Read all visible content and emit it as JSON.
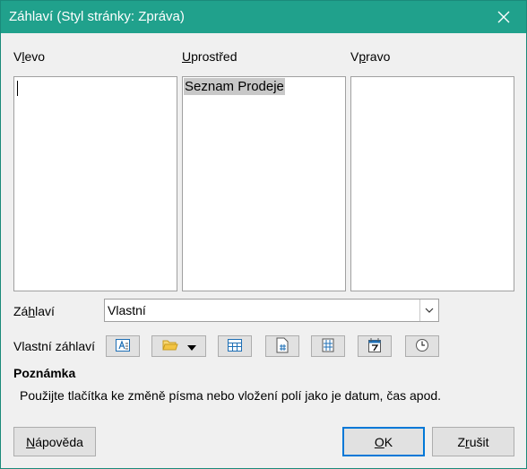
{
  "window": {
    "title": "Záhlaví (Styl stránky: Zpráva)"
  },
  "panes": {
    "left_label_pre": "V",
    "left_label_acc": "l",
    "left_label_post": "evo",
    "center_label_pre": "",
    "center_label_acc": "U",
    "center_label_post": "prostřed",
    "right_label_pre": "V",
    "right_label_acc": "p",
    "right_label_post": "ravo",
    "center_content": "Seznam Prodeje"
  },
  "header": {
    "label_pre": "Zá",
    "label_acc": "h",
    "label_post": "laví",
    "selected_value": "Vlastní"
  },
  "custom_header": {
    "label": "Vlastní záhlaví",
    "icons": [
      "text-attributes-icon",
      "open-file-icon",
      "title-icon",
      "sheet-name-icon",
      "page-icon",
      "date-icon",
      "time-icon"
    ]
  },
  "note": {
    "heading": "Poznámka",
    "text": "Použijte tlačítka ke změně písma nebo vložení polí jako je datum, čas apod."
  },
  "buttons": {
    "help_acc": "N",
    "help_post": "ápověda",
    "ok_pre": "",
    "ok_acc": "O",
    "ok_post": "K",
    "cancel_pre": "Z",
    "cancel_acc": "r",
    "cancel_post": "ušit"
  }
}
